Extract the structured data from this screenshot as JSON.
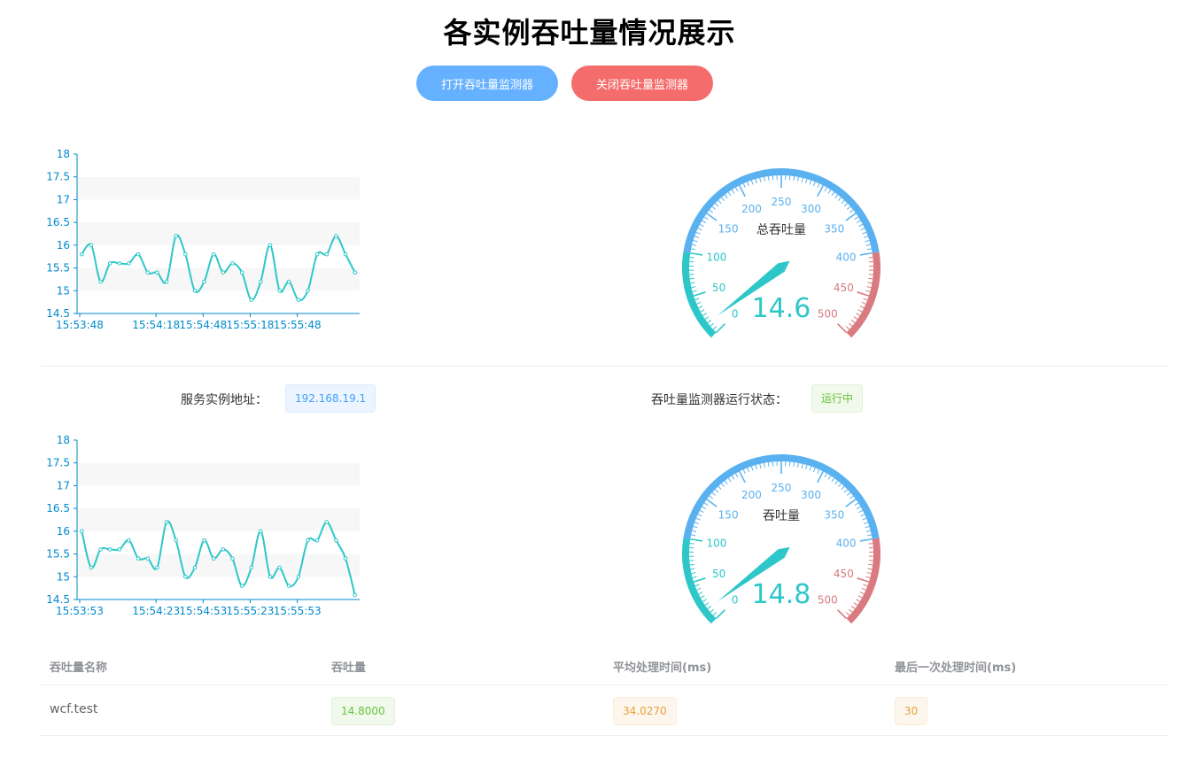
{
  "header": {
    "title": "各实例吞吐量情况展示",
    "open_button": "打开吞吐量监测器",
    "close_button": "关闭吞吐量监测器"
  },
  "info": {
    "address_label": "服务实例地址：",
    "address_value": "192.168.19.1",
    "status_label": "吞吐量监测器运行状态：",
    "status_value": "运行中"
  },
  "colors": {
    "line": "#2ec7c9",
    "axis": "#008acd",
    "gauge_low": "#2ec7c9",
    "gauge_mid": "#5ab1ef",
    "gauge_high": "#d87a80",
    "open_button": "#66b1ff",
    "close_button": "#f56c6c"
  },
  "chart_data": [
    {
      "type": "line",
      "x_ticks": [
        "15:53:48",
        "15:54:18",
        "15:54:48",
        "15:55:18",
        "15:55:48"
      ],
      "y_ticks": [
        "14.5",
        "15",
        "15.5",
        "16",
        "16.5",
        "17",
        "17.5",
        "18"
      ],
      "ylim": [
        14.5,
        18
      ],
      "values": [
        15.8,
        16.0,
        15.2,
        15.6,
        15.6,
        15.6,
        15.8,
        15.4,
        15.4,
        15.2,
        16.2,
        15.8,
        15.0,
        15.2,
        15.8,
        15.4,
        15.6,
        15.4,
        14.8,
        15.2,
        16.0,
        15.0,
        15.2,
        14.8,
        15.0,
        15.8,
        15.8,
        16.2,
        15.8,
        15.4
      ],
      "grid": "alternating bands"
    },
    {
      "type": "gauge",
      "title": "总吞吐量",
      "value": 14.6,
      "value_label": "14.6",
      "min": 0,
      "max": 500,
      "tick_labels": [
        "0",
        "50",
        "100",
        "150",
        "200",
        "250",
        "300",
        "350",
        "400",
        "450",
        "500"
      ]
    },
    {
      "type": "line",
      "x_ticks": [
        "15:53:53",
        "15:54:23",
        "15:54:53",
        "15:55:23",
        "15:55:53"
      ],
      "y_ticks": [
        "14.5",
        "15",
        "15.5",
        "16",
        "16.5",
        "17",
        "17.5",
        "18"
      ],
      "ylim": [
        14.5,
        18
      ],
      "values": [
        16.0,
        15.2,
        15.6,
        15.6,
        15.6,
        15.8,
        15.4,
        15.4,
        15.2,
        16.2,
        15.8,
        15.0,
        15.2,
        15.8,
        15.4,
        15.6,
        15.4,
        14.8,
        15.2,
        16.0,
        15.0,
        15.2,
        14.8,
        15.0,
        15.8,
        15.8,
        16.2,
        15.8,
        15.4,
        14.6
      ],
      "grid": "alternating bands"
    },
    {
      "type": "gauge",
      "title": "吞吐量",
      "value": 14.8,
      "value_label": "14.8",
      "min": 0,
      "max": 500,
      "tick_labels": [
        "0",
        "50",
        "100",
        "150",
        "200",
        "250",
        "300",
        "350",
        "400",
        "450",
        "500"
      ]
    }
  ],
  "table": {
    "headers": [
      "吞吐量名称",
      "吞吐量",
      "平均处理时间(ms)",
      "最后一次处理时间(ms)"
    ],
    "rows": [
      {
        "name": "wcf.test",
        "throughput": "14.8000",
        "avg_time": "34.0270",
        "last_time": "30"
      }
    ]
  }
}
